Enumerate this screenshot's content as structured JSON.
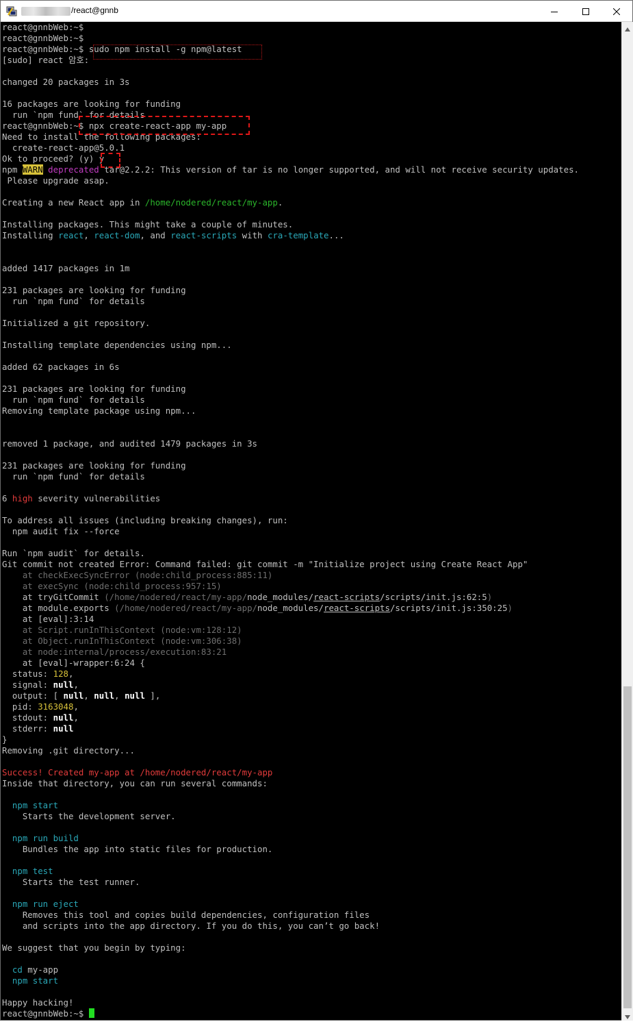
{
  "window": {
    "title": "/react@gnnb",
    "controls": {
      "minimize": "minimize",
      "maximize": "maximize",
      "close": "close"
    }
  },
  "terminal": {
    "lines": [
      [
        {
          "t": "react@gnnbWeb:~$",
          "c": "w"
        }
      ],
      [
        {
          "t": "react@gnnbWeb:~$",
          "c": "w"
        }
      ],
      [
        {
          "t": "react@gnnbWeb:~$ sudo npm install -g npm@latest",
          "c": "w"
        }
      ],
      [
        {
          "t": "[sudo] react 암호:",
          "c": "w"
        }
      ],
      [
        {
          "t": "",
          "c": "w"
        }
      ],
      [
        {
          "t": "changed 20 packages in 3s",
          "c": "w"
        }
      ],
      [
        {
          "t": "",
          "c": "w"
        }
      ],
      [
        {
          "t": "16 packages are looking for funding",
          "c": "w"
        }
      ],
      [
        {
          "t": "  run `npm fund` for details",
          "c": "w"
        }
      ],
      [
        {
          "t": "react@gnnbWeb:~$ npx create-react-app my-app",
          "c": "w"
        }
      ],
      [
        {
          "t": "Need to install the following packages:",
          "c": "w"
        }
      ],
      [
        {
          "t": "  create-react-app@5.0.1",
          "c": "w"
        }
      ],
      [
        {
          "t": "Ok to proceed? (y) y",
          "c": "w"
        }
      ],
      [
        {
          "t": "npm ",
          "c": "w"
        },
        {
          "t": "WARN",
          "c": "warn"
        },
        {
          "t": " ",
          "c": "w"
        },
        {
          "t": "deprecated",
          "c": "magenta"
        },
        {
          "t": " tar@2.2.2: This version of tar is no longer supported, and will not receive security updates.",
          "c": "w"
        }
      ],
      [
        {
          "t": " Please upgrade asap.",
          "c": "w"
        }
      ],
      [
        {
          "t": "",
          "c": "w"
        }
      ],
      [
        {
          "t": "Creating a new React app in ",
          "c": "w"
        },
        {
          "t": "/home/nodered/react/my-app",
          "c": "green"
        },
        {
          "t": ".",
          "c": "w"
        }
      ],
      [
        {
          "t": "",
          "c": "w"
        }
      ],
      [
        {
          "t": "Installing packages. This might take a couple of minutes.",
          "c": "w"
        }
      ],
      [
        {
          "t": "Installing ",
          "c": "w"
        },
        {
          "t": "react",
          "c": "cyan"
        },
        {
          "t": ", ",
          "c": "w"
        },
        {
          "t": "react-dom",
          "c": "cyan"
        },
        {
          "t": ", and ",
          "c": "w"
        },
        {
          "t": "react-scripts",
          "c": "cyan"
        },
        {
          "t": " with ",
          "c": "w"
        },
        {
          "t": "cra-template",
          "c": "cyan"
        },
        {
          "t": "...",
          "c": "w"
        }
      ],
      [
        {
          "t": "",
          "c": "w"
        }
      ],
      [
        {
          "t": "",
          "c": "w"
        }
      ],
      [
        {
          "t": "added 1417 packages in 1m",
          "c": "w"
        }
      ],
      [
        {
          "t": "",
          "c": "w"
        }
      ],
      [
        {
          "t": "231 packages are looking for funding",
          "c": "w"
        }
      ],
      [
        {
          "t": "  run `npm fund` for details",
          "c": "w"
        }
      ],
      [
        {
          "t": "",
          "c": "w"
        }
      ],
      [
        {
          "t": "Initialized a git repository.",
          "c": "w"
        }
      ],
      [
        {
          "t": "",
          "c": "w"
        }
      ],
      [
        {
          "t": "Installing template dependencies using npm...",
          "c": "w"
        }
      ],
      [
        {
          "t": "",
          "c": "w"
        }
      ],
      [
        {
          "t": "added 62 packages in 6s",
          "c": "w"
        }
      ],
      [
        {
          "t": "",
          "c": "w"
        }
      ],
      [
        {
          "t": "231 packages are looking for funding",
          "c": "w"
        }
      ],
      [
        {
          "t": "  run `npm fund` for details",
          "c": "w"
        }
      ],
      [
        {
          "t": "Removing template package using npm...",
          "c": "w"
        }
      ],
      [
        {
          "t": "",
          "c": "w"
        }
      ],
      [
        {
          "t": "",
          "c": "w"
        }
      ],
      [
        {
          "t": "removed 1 package, and audited 1479 packages in 3s",
          "c": "w"
        }
      ],
      [
        {
          "t": "",
          "c": "w"
        }
      ],
      [
        {
          "t": "231 packages are looking for funding",
          "c": "w"
        }
      ],
      [
        {
          "t": "  run `npm fund` for details",
          "c": "w"
        }
      ],
      [
        {
          "t": "",
          "c": "w"
        }
      ],
      [
        {
          "t": "6 ",
          "c": "w"
        },
        {
          "t": "high",
          "c": "red"
        },
        {
          "t": " severity vulnerabilities",
          "c": "w"
        }
      ],
      [
        {
          "t": "",
          "c": "w"
        }
      ],
      [
        {
          "t": "To address all issues (including breaking changes), run:",
          "c": "w"
        }
      ],
      [
        {
          "t": "  npm audit fix --force",
          "c": "w"
        }
      ],
      [
        {
          "t": "",
          "c": "w"
        }
      ],
      [
        {
          "t": "Run `npm audit` for details.",
          "c": "w"
        }
      ],
      [
        {
          "t": "Git commit not created Error: Command failed: git commit -m \"Initialize project using Create React App\"",
          "c": "w"
        }
      ],
      [
        {
          "t": "    at checkExecSyncError (node:child_process:885:11)",
          "c": "dim"
        }
      ],
      [
        {
          "t": "    at execSync (node:child_process:957:15)",
          "c": "dim"
        }
      ],
      [
        {
          "t": "    at tryGitCommit ",
          "c": "w"
        },
        {
          "t": "(/home/nodered/react/my-app/",
          "c": "dim"
        },
        {
          "t": "node_modules/",
          "c": "w"
        },
        {
          "t": "react-scripts",
          "c": "w ul"
        },
        {
          "t": "/scripts/init.js:62:5",
          "c": "w"
        },
        {
          "t": ")",
          "c": "dim"
        }
      ],
      [
        {
          "t": "    at module.exports ",
          "c": "w"
        },
        {
          "t": "(/home/nodered/react/my-app/",
          "c": "dim"
        },
        {
          "t": "node_modules/",
          "c": "w"
        },
        {
          "t": "react-scripts",
          "c": "w ul"
        },
        {
          "t": "/scripts/init.js:350:25",
          "c": "w"
        },
        {
          "t": ")",
          "c": "dim"
        }
      ],
      [
        {
          "t": "    at [eval]:3:14",
          "c": "w"
        }
      ],
      [
        {
          "t": "    at Script.runInThisContext (node:vm:128:12)",
          "c": "dim"
        }
      ],
      [
        {
          "t": "    at Object.runInThisContext (node:vm:306:38)",
          "c": "dim"
        }
      ],
      [
        {
          "t": "    at node:internal/process/execution:83:21",
          "c": "dim"
        }
      ],
      [
        {
          "t": "    at [eval]-wrapper:6:24 {",
          "c": "w"
        }
      ],
      [
        {
          "t": "  status: ",
          "c": "w"
        },
        {
          "t": "128",
          "c": "yellow"
        },
        {
          "t": ",",
          "c": "w"
        }
      ],
      [
        {
          "t": "  signal: ",
          "c": "w"
        },
        {
          "t": "null",
          "c": "bw"
        },
        {
          "t": ",",
          "c": "w"
        }
      ],
      [
        {
          "t": "  output: [ ",
          "c": "w"
        },
        {
          "t": "null",
          "c": "bw"
        },
        {
          "t": ", ",
          "c": "w"
        },
        {
          "t": "null",
          "c": "bw"
        },
        {
          "t": ", ",
          "c": "w"
        },
        {
          "t": "null",
          "c": "bw"
        },
        {
          "t": " ],",
          "c": "w"
        }
      ],
      [
        {
          "t": "  pid: ",
          "c": "w"
        },
        {
          "t": "3163048",
          "c": "yellow"
        },
        {
          "t": ",",
          "c": "w"
        }
      ],
      [
        {
          "t": "  stdout: ",
          "c": "w"
        },
        {
          "t": "null",
          "c": "bw"
        },
        {
          "t": ",",
          "c": "w"
        }
      ],
      [
        {
          "t": "  stderr: ",
          "c": "w"
        },
        {
          "t": "null",
          "c": "bw"
        }
      ],
      [
        {
          "t": "}",
          "c": "w"
        }
      ],
      [
        {
          "t": "Removing .git directory...",
          "c": "w"
        }
      ],
      [
        {
          "t": "",
          "c": "w"
        }
      ],
      [
        {
          "t": "Success! Created my-app at /home/nodered/react/my-app",
          "c": "red"
        }
      ],
      [
        {
          "t": "Inside that directory, you can run several commands:",
          "c": "w"
        }
      ],
      [
        {
          "t": "",
          "c": "w"
        }
      ],
      [
        {
          "t": "  npm start",
          "c": "cyan"
        }
      ],
      [
        {
          "t": "    Starts the development server.",
          "c": "w"
        }
      ],
      [
        {
          "t": "",
          "c": "w"
        }
      ],
      [
        {
          "t": "  npm run build",
          "c": "cyan"
        }
      ],
      [
        {
          "t": "    Bundles the app into static files for production.",
          "c": "w"
        }
      ],
      [
        {
          "t": "",
          "c": "w"
        }
      ],
      [
        {
          "t": "  npm test",
          "c": "cyan"
        }
      ],
      [
        {
          "t": "    Starts the test runner.",
          "c": "w"
        }
      ],
      [
        {
          "t": "",
          "c": "w"
        }
      ],
      [
        {
          "t": "  npm run eject",
          "c": "cyan"
        }
      ],
      [
        {
          "t": "    Removes this tool and copies build dependencies, configuration files",
          "c": "w"
        }
      ],
      [
        {
          "t": "    and scripts into the app directory. If you do this, you can’t go back!",
          "c": "w"
        }
      ],
      [
        {
          "t": "",
          "c": "w"
        }
      ],
      [
        {
          "t": "We suggest that you begin by typing:",
          "c": "w"
        }
      ],
      [
        {
          "t": "",
          "c": "w"
        }
      ],
      [
        {
          "t": "  cd",
          "c": "cyan"
        },
        {
          "t": " my-app",
          "c": "w"
        }
      ],
      [
        {
          "t": "  npm start",
          "c": "cyan"
        }
      ],
      [
        {
          "t": "",
          "c": "w"
        }
      ],
      [
        {
          "t": "Happy hacking!",
          "c": "w"
        }
      ],
      [
        {
          "t": "react@gnnbWeb:~$ ",
          "c": "w"
        }
      ]
    ]
  }
}
